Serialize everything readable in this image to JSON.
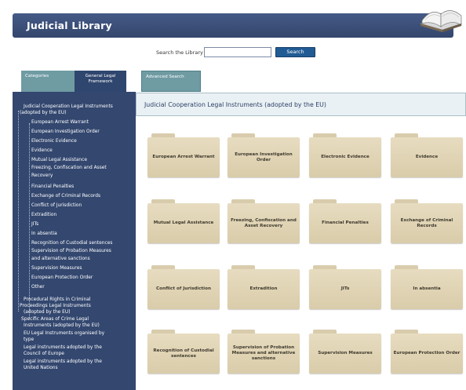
{
  "header": {
    "title": "Judicial Library"
  },
  "search": {
    "label": "Search the Library",
    "value": "",
    "button_label": "Search"
  },
  "tabs": [
    {
      "label": "Categories"
    },
    {
      "label": "General Legal Framework"
    },
    {
      "label": "Advanced Search"
    }
  ],
  "sidebar": {
    "items": [
      {
        "label": "Judicial Cooperation Legal Instruments"
      },
      {
        "label": "(adopted by the EU)"
      },
      {
        "label": "European Arrest Warrant"
      },
      {
        "label": "European Investigation Order"
      },
      {
        "label": "Electronic Evidence"
      },
      {
        "label": "Evidence"
      },
      {
        "label": "Mutual Legal Assistance"
      },
      {
        "label": "Freezing, Confiscation and Asset"
      },
      {
        "label": "Recovery"
      },
      {
        "label": "Financial Penalties"
      },
      {
        "label": "Exchange of Criminal Records"
      },
      {
        "label": "Conflict of Jurisdiction"
      },
      {
        "label": "Extradition"
      },
      {
        "label": "JITs"
      },
      {
        "label": "In absentia"
      },
      {
        "label": "Recognition of Custodial sentences"
      },
      {
        "label": "Supervision of Probation Measures"
      },
      {
        "label": "and alternative sanctions"
      },
      {
        "label": "Supervision Measures"
      },
      {
        "label": "European Protection Order"
      },
      {
        "label": "Other"
      },
      {
        "label": "Procedural Rights in Criminal"
      },
      {
        "label": "Proceedings Legal Instruments"
      },
      {
        "label": "(adopted by the EU)"
      },
      {
        "label": "Specific Areas of Crime Legal"
      },
      {
        "label": "Instruments (adopted by the EU)"
      },
      {
        "label": "EU Legal Instruments organised by"
      },
      {
        "label": "type"
      },
      {
        "label": "Legal instruments adopted by the"
      },
      {
        "label": "Council of Europe"
      },
      {
        "label": "Legal instruments adopted by the"
      },
      {
        "label": "United Nations"
      }
    ]
  },
  "main": {
    "title": "Judicial Cooperation Legal Instruments (adopted by the EU)",
    "folders": [
      {
        "label": "European Arrest Warrant"
      },
      {
        "label": "European Investigation Order"
      },
      {
        "label": "Electronic Evidence"
      },
      {
        "label": "Evidence"
      },
      {
        "label": "Mutual Legal Assistance"
      },
      {
        "label": "Freezing, Confiscation and Asset Recovery"
      },
      {
        "label": "Financial Penalties"
      },
      {
        "label": "Exchange of Criminal Records"
      },
      {
        "label": "Conflict of Jurisdiction"
      },
      {
        "label": "Extradition"
      },
      {
        "label": "JITs"
      },
      {
        "label": "In absentia"
      },
      {
        "label": "Recognition of Custodial sentences"
      },
      {
        "label": "Supervision of Probation Measures and alternative sanctions"
      },
      {
        "label": "Supervision Measures"
      },
      {
        "label": "European Protection Order"
      }
    ]
  },
  "colors": {
    "banner": "#3b4f79",
    "sidebar": "#33476f",
    "tab_inactive": "#6f9ba3",
    "search_button": "#205b94",
    "folder": "#e3d8bb"
  }
}
